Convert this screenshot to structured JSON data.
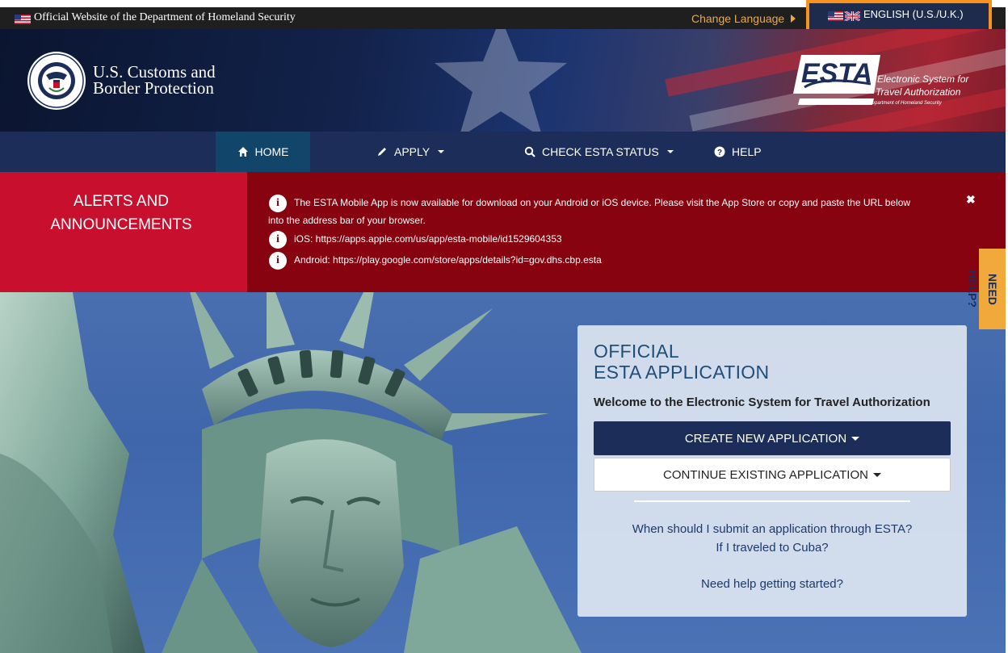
{
  "gov_banner": {
    "official_text": "Official Website of the Department of Homeland Security",
    "change_language": "Change Language",
    "language_button": "ENGLISH (U.S./U.K.)"
  },
  "header": {
    "agency_line1": "U.S. Customs and",
    "agency_line2": "Border Protection",
    "esta_logo": "ESTA",
    "esta_line1": "Electronic System for",
    "esta_line2": "Travel Authorization",
    "esta_line3": "U.S. Department of Homeland Security"
  },
  "nav": {
    "items": [
      {
        "label": "HOME",
        "icon": "home-icon",
        "active": true
      },
      {
        "label": "APPLY",
        "icon": "pencil-icon",
        "dropdown": true
      },
      {
        "label": "CHECK ESTA STATUS",
        "icon": "search-icon",
        "dropdown": true
      },
      {
        "label": "HELP",
        "icon": "question-circle-icon"
      }
    ]
  },
  "alerts": {
    "title_line1": "ALERTS AND",
    "title_line2": "ANNOUNCEMENTS",
    "messages": [
      {
        "line1": "The ESTA Mobile App is now available for download on your Android or iOS device. Please visit the App Store or copy and paste the URL below",
        "line2": "into the address bar of your browser."
      },
      {
        "line1": "iOS: https://apps.apple.com/us/app/esta-mobile/id1529604353"
      },
      {
        "line1": "Android: https://play.google.com/store/apps/details?id=gov.dhs.cbp.esta"
      }
    ],
    "close": "✖"
  },
  "need_help": "NEED HELP?",
  "panel": {
    "heading_line1": "OFFICIAL",
    "heading_line2": "ESTA APPLICATION",
    "welcome": "Welcome to the Electronic System for Travel Authorization",
    "create_button": "CREATE NEW APPLICATION",
    "continue_button": "CONTINUE EXISTING APPLICATION",
    "links": [
      "When should I submit an application through ESTA?",
      "If I traveled to Cuba?",
      "Need help getting started?"
    ]
  },
  "colors": {
    "nav_bg": "#1c2d5a",
    "nav_active": "#12456a",
    "alert_red": "#c8102e",
    "alert_dark_red": "#86030f",
    "accent_orange": "#f7921e",
    "need_help_bg": "#f0a93a"
  }
}
